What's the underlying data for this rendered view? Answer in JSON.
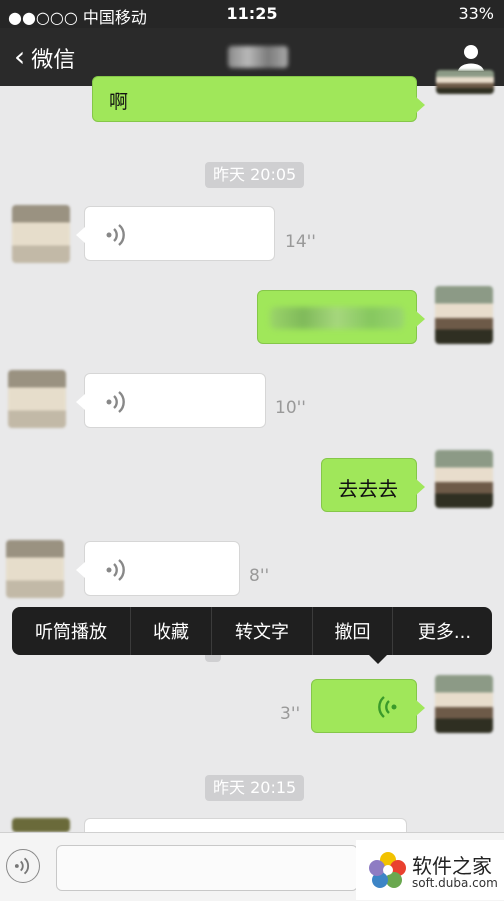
{
  "status_bar": {
    "carrier": "●●○○○ 中国移动",
    "time": "11:25",
    "battery": "33%"
  },
  "nav": {
    "back_label": "微信"
  },
  "messages": {
    "first_text": "啊",
    "ts1": "昨天 20:05",
    "dur1": "14''",
    "dur2": "10''",
    "sent_text": "去去去",
    "dur3": "8''",
    "dur4": "3''",
    "ts2": "昨天 20:15"
  },
  "context_menu": [
    "听筒播放",
    "收藏",
    "转文字",
    "撤回",
    "更多..."
  ],
  "watermark": {
    "title": "软件之家",
    "url": "soft.duba.com"
  },
  "colors": {
    "green_bubble": "#a0e75a",
    "chat_bg": "#e9e9ea",
    "nav_bg": "#2a2a2a"
  }
}
